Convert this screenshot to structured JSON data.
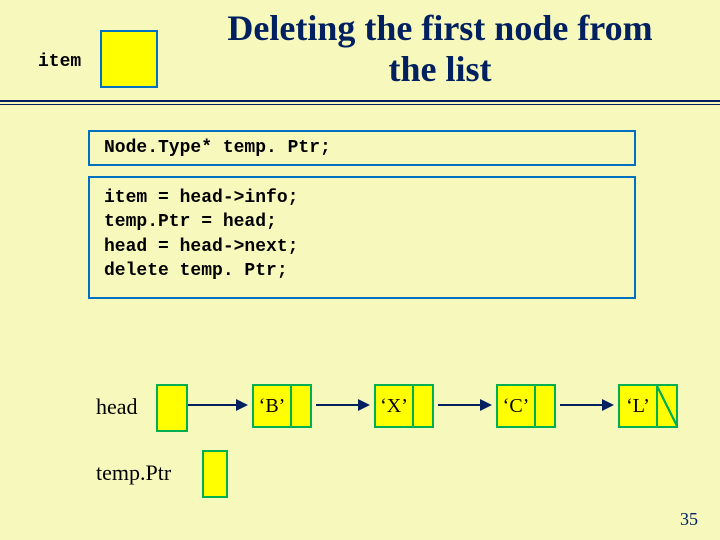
{
  "title_line1": "Deleting the first node from",
  "title_line2": "the list",
  "item_label": "item",
  "code": {
    "decl": "Node.Type*   temp. Ptr;",
    "l1": "item = head->info;",
    "l2": "temp.Ptr = head;",
    "l3": "head = head->next;",
    "l4": "delete  temp. Ptr;"
  },
  "head_label": "head",
  "tempptr_label": "temp.Ptr",
  "nodes": [
    "‘B’",
    "‘X’",
    "‘C’",
    "‘L’"
  ],
  "page_number": "35"
}
